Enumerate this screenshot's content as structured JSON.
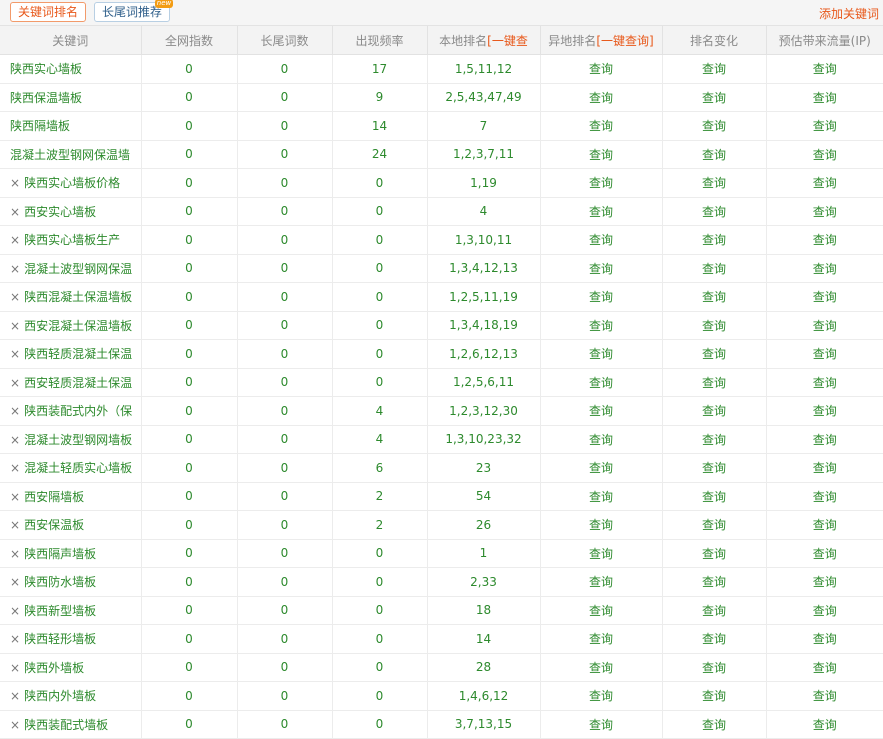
{
  "tabs": {
    "active": "关键词排名",
    "inactive": "长尾词推荐",
    "badge": "new"
  },
  "add_keyword": "添加关键词",
  "columns": {
    "keyword": "关键词",
    "index": "全网指数",
    "longtail": "长尾词数",
    "freq": "出现频率",
    "local": "本地排名",
    "local_link": "[一键查",
    "remote": "异地排名",
    "remote_link": "[一键查询]",
    "change": "排名变化",
    "traffic": "预估带来流量(IP)"
  },
  "query_label": "查询",
  "delete_mark": "×",
  "rows": [
    {
      "keyword": "陕西实心墙板",
      "deletable": false,
      "index": "0",
      "longtail": "0",
      "freq": "17",
      "local": "1,5,11,12"
    },
    {
      "keyword": "陕西保温墙板",
      "deletable": false,
      "index": "0",
      "longtail": "0",
      "freq": "9",
      "local": "2,5,43,47,49"
    },
    {
      "keyword": "陕西隔墙板",
      "deletable": false,
      "index": "0",
      "longtail": "0",
      "freq": "14",
      "local": "7"
    },
    {
      "keyword": "混凝土波型钢网保温墙",
      "deletable": false,
      "index": "0",
      "longtail": "0",
      "freq": "24",
      "local": "1,2,3,7,11"
    },
    {
      "keyword": "陕西实心墙板价格",
      "deletable": true,
      "index": "0",
      "longtail": "0",
      "freq": "0",
      "local": "1,19"
    },
    {
      "keyword": "西安实心墙板",
      "deletable": true,
      "index": "0",
      "longtail": "0",
      "freq": "0",
      "local": "4"
    },
    {
      "keyword": "陕西实心墙板生产",
      "deletable": true,
      "index": "0",
      "longtail": "0",
      "freq": "0",
      "local": "1,3,10,11"
    },
    {
      "keyword": "混凝土波型钢网保温",
      "deletable": true,
      "index": "0",
      "longtail": "0",
      "freq": "0",
      "local": "1,3,4,12,13"
    },
    {
      "keyword": "陕西混凝土保温墙板",
      "deletable": true,
      "index": "0",
      "longtail": "0",
      "freq": "0",
      "local": "1,2,5,11,19"
    },
    {
      "keyword": "西安混凝土保温墙板",
      "deletable": true,
      "index": "0",
      "longtail": "0",
      "freq": "0",
      "local": "1,3,4,18,19"
    },
    {
      "keyword": "陕西轻质混凝土保温",
      "deletable": true,
      "index": "0",
      "longtail": "0",
      "freq": "0",
      "local": "1,2,6,12,13"
    },
    {
      "keyword": "西安轻质混凝土保温",
      "deletable": true,
      "index": "0",
      "longtail": "0",
      "freq": "0",
      "local": "1,2,5,6,11"
    },
    {
      "keyword": "陕西装配式内外（保",
      "deletable": true,
      "index": "0",
      "longtail": "0",
      "freq": "4",
      "local": "1,2,3,12,30"
    },
    {
      "keyword": "混凝土波型钢网墙板",
      "deletable": true,
      "index": "0",
      "longtail": "0",
      "freq": "4",
      "local": "1,3,10,23,32"
    },
    {
      "keyword": "混凝土轻质实心墙板",
      "deletable": true,
      "index": "0",
      "longtail": "0",
      "freq": "6",
      "local": "23"
    },
    {
      "keyword": "西安隔墙板",
      "deletable": true,
      "index": "0",
      "longtail": "0",
      "freq": "2",
      "local": "54"
    },
    {
      "keyword": "西安保温板",
      "deletable": true,
      "index": "0",
      "longtail": "0",
      "freq": "2",
      "local": "26"
    },
    {
      "keyword": "陕西隔声墙板",
      "deletable": true,
      "index": "0",
      "longtail": "0",
      "freq": "0",
      "local": "1"
    },
    {
      "keyword": "陕西防水墙板",
      "deletable": true,
      "index": "0",
      "longtail": "0",
      "freq": "0",
      "local": "2,33"
    },
    {
      "keyword": "陕西新型墙板",
      "deletable": true,
      "index": "0",
      "longtail": "0",
      "freq": "0",
      "local": "18"
    },
    {
      "keyword": "陕西轻形墙板",
      "deletable": true,
      "index": "0",
      "longtail": "0",
      "freq": "0",
      "local": "14"
    },
    {
      "keyword": "陕西外墙板",
      "deletable": true,
      "index": "0",
      "longtail": "0",
      "freq": "0",
      "local": "28"
    },
    {
      "keyword": "陕西内外墙板",
      "deletable": true,
      "index": "0",
      "longtail": "0",
      "freq": "0",
      "local": "1,4,6,12"
    },
    {
      "keyword": "陕西装配式墙板",
      "deletable": true,
      "index": "0",
      "longtail": "0",
      "freq": "0",
      "local": "3,7,13,15"
    }
  ]
}
